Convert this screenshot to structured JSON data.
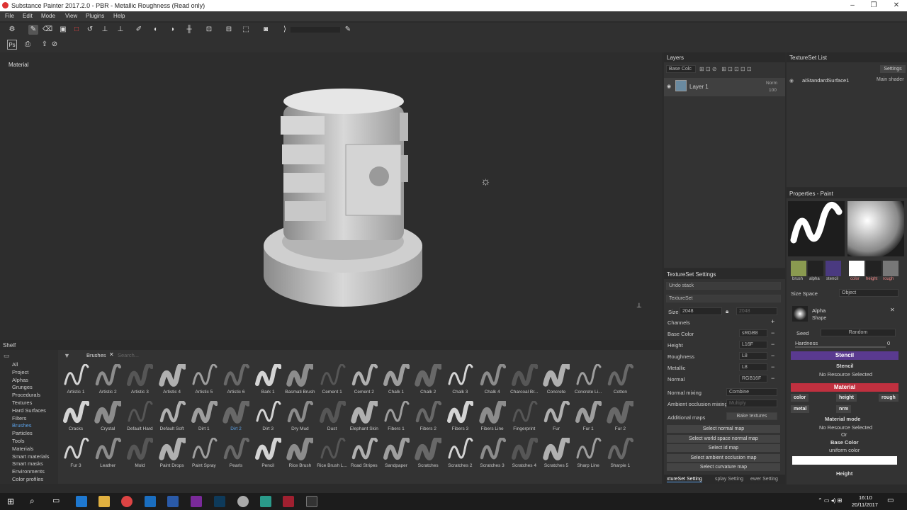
{
  "title": "Substance Painter 2017.2.0 - PBR - Metallic Roughness (Read only)",
  "menu": [
    "File",
    "Edit",
    "Mode",
    "View",
    "Plugins",
    "Help"
  ],
  "viewport": {
    "label": "Material"
  },
  "layers": {
    "title": "Layers",
    "channel": "Base Colc",
    "layer_name": "Layer 1",
    "blend": "Norm",
    "opacity": "100"
  },
  "textureset_list": {
    "title": "TextureSet List",
    "settings_btn": "Settings",
    "surface": "aiStandardSurface1",
    "shader": "Main shader"
  },
  "properties": {
    "title": "Properties - Paint",
    "tabs": [
      "brush",
      "alpha",
      "stencil"
    ],
    "mat_tabs": [
      "color",
      "height",
      "rough"
    ],
    "size_space_label": "Size Space",
    "size_space": "Object",
    "alpha_label": "Alpha",
    "alpha_sub": "Shape",
    "seed": "Seed",
    "random": "Random",
    "hardness": "Hardness",
    "hardness_val": "0",
    "stencil": "Stencil",
    "stencil_sub": "Stencil",
    "no_res": "No Resource Selected",
    "material": "Material",
    "chips": [
      "color",
      "height",
      "rough",
      "metal",
      "nrm"
    ],
    "material_mode": "Material mode",
    "no_res2": "No Resource Selected",
    "or": "Or",
    "base_color": "Base Color",
    "uniform": "uniform color",
    "height": "Height"
  },
  "ts_settings": {
    "title": "TextureSet Settings",
    "undo": "Undo stack",
    "textureset": "TextureSet",
    "size_label": "Size",
    "size": "2048",
    "size2": "2048",
    "channels": "Channels",
    "rows": [
      {
        "name": "Base Color",
        "fmt": "sRGB8"
      },
      {
        "name": "Height",
        "fmt": "L16F"
      },
      {
        "name": "Roughness",
        "fmt": "L8"
      },
      {
        "name": "Metallic",
        "fmt": "L8"
      },
      {
        "name": "Normal",
        "fmt": "RGB16F"
      }
    ],
    "normal_mixing": "Normal mixing",
    "combine": "Combine",
    "ao_mixing": "Ambient occlusion mixing",
    "multiply": "Multiply",
    "additional": "Additional maps",
    "bake": "Bake textures",
    "buttons": [
      "Select normal map",
      "Select world space normal map",
      "Select id map",
      "Select ambient occlusion map",
      "Select curvature map"
    ],
    "bottom_tabs": [
      "xtureSet Setting",
      "splay Setting",
      "ewer Setting"
    ]
  },
  "shelf": {
    "title": "Shelf",
    "filter": "Brushes",
    "search": "Search...",
    "categories": [
      "All",
      "Project",
      "Alphas",
      "Grunges",
      "Procedurals",
      "Textures",
      "Hard Surfaces",
      "Filters",
      "Brushes",
      "Particles",
      "Tools",
      "Materials",
      "Smart materials",
      "Smart masks",
      "Environments",
      "Color profiles"
    ],
    "brushes": [
      "Artistic 1",
      "Artistic 2",
      "Artistic 3",
      "Artistic 4",
      "Artistic 5",
      "Artistic 6",
      "Bark 1",
      "Basmati Brush",
      "Cement 1",
      "Cement 2",
      "Chalk 1",
      "Chalk 2",
      "Chalk 3",
      "Chalk 4",
      "Charcoal Br...",
      "Concrete",
      "Concrete Li...",
      "Cotton",
      "Cracks",
      "Crystal",
      "Default Hard",
      "Default Soft",
      "Dirt 1",
      "Dirt 2",
      "Dirt 3",
      "Dry Mud",
      "Dust",
      "Elephant Skin",
      "Fibers 1",
      "Fibers 2",
      "Fibers 3",
      "Fibers Line",
      "Fingerprint",
      "Fur",
      "Fur 1",
      "Fur 2",
      "Fur 3",
      "Leather",
      "Mold",
      "Paint Drops",
      "Paint Spray",
      "Pearls",
      "Pencil",
      "Rice Brush",
      "Rice Brush L...",
      "Road Stripes",
      "Sandpaper",
      "Scratches",
      "Scratches 2",
      "Scratches 3",
      "Scratches 4",
      "Scratches 5",
      "Sharp Line",
      "Sharpie 1"
    ]
  },
  "taskbar": {
    "time": "16:10",
    "date": "20/11/2017"
  },
  "colors": {
    "accent_purple": "#6a4aa0",
    "accent_red": "#c0303f",
    "selected_blue": "#5aa0e6"
  }
}
